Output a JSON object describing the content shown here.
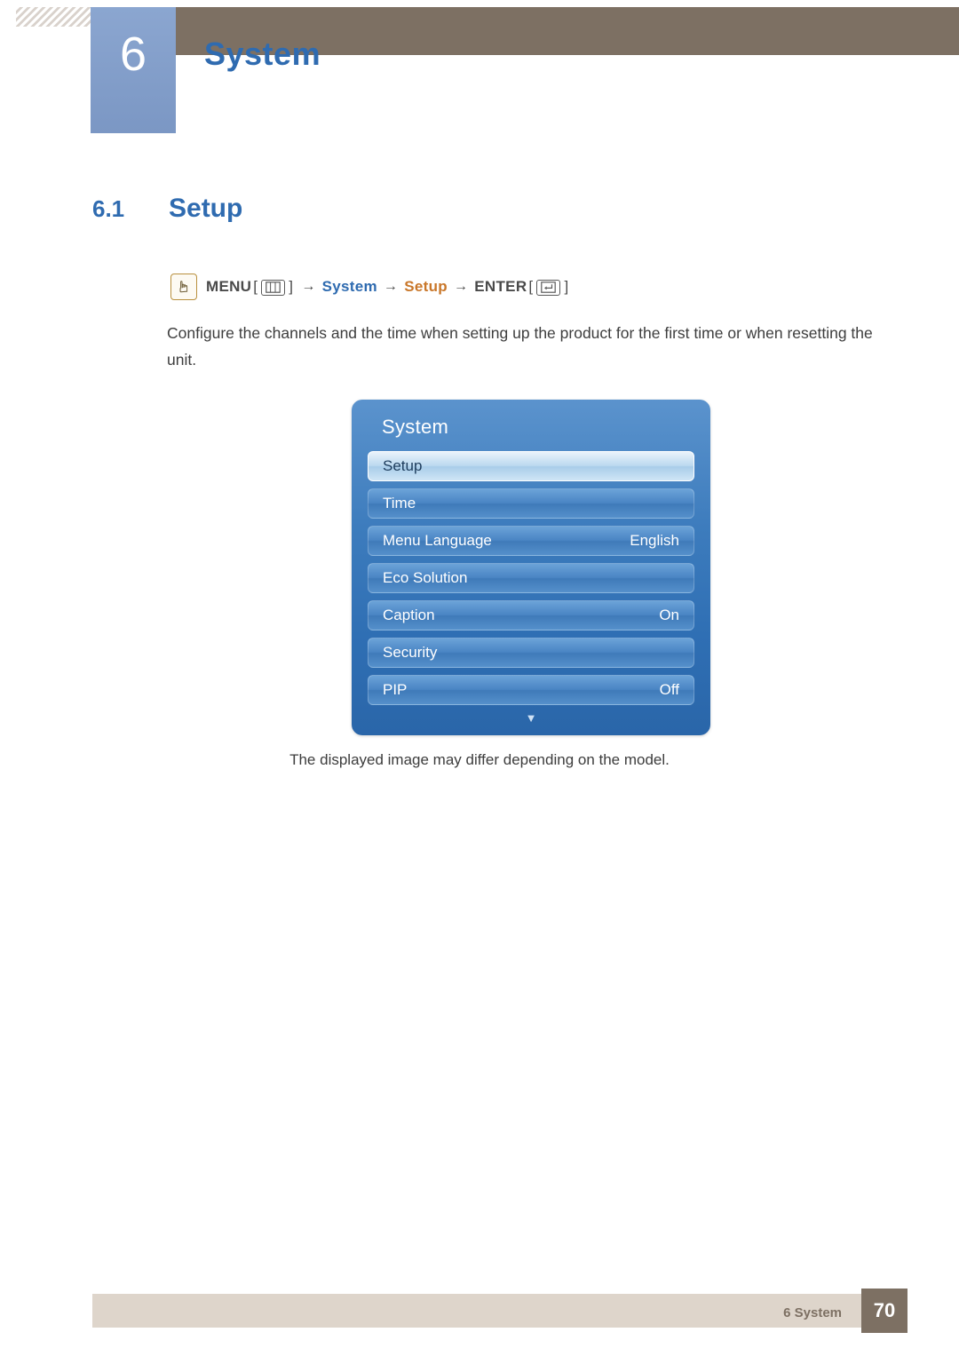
{
  "header": {
    "chapter_number": "6",
    "chapter_title": "System"
  },
  "section": {
    "number": "6.1",
    "title": "Setup"
  },
  "menu_path": {
    "icon": "hand-pointer-icon",
    "menu_label": "MENU",
    "menu_key_icon": "menu-key-icon",
    "arrow": "→",
    "step1": "System",
    "step2": "Setup",
    "enter_label": "ENTER",
    "enter_key_icon": "enter-key-icon",
    "bracket_open": "[",
    "bracket_close": "]"
  },
  "body": {
    "paragraph": "Configure the channels and the time when setting up the product for the first time or when resetting the unit."
  },
  "osd": {
    "title": "System",
    "rows": [
      {
        "label": "Setup",
        "value": "",
        "selected": true
      },
      {
        "label": "Time",
        "value": "",
        "selected": false
      },
      {
        "label": "Menu Language",
        "value": "English",
        "selected": false
      },
      {
        "label": "Eco Solution",
        "value": "",
        "selected": false
      },
      {
        "label": "Caption",
        "value": "On",
        "selected": false
      },
      {
        "label": "Security",
        "value": "",
        "selected": false
      },
      {
        "label": "PIP",
        "value": "Off",
        "selected": false
      }
    ],
    "scroll_arrow": "▼",
    "caption": "The displayed image may differ depending on the model."
  },
  "footer": {
    "label": "6 System",
    "page": "70"
  },
  "colors": {
    "accent_blue": "#2f6bb0",
    "accent_orange": "#c9772a",
    "header_brown": "#7d7063",
    "tab_blue": "#7f9bc7",
    "footer_band": "#ded5cb"
  }
}
